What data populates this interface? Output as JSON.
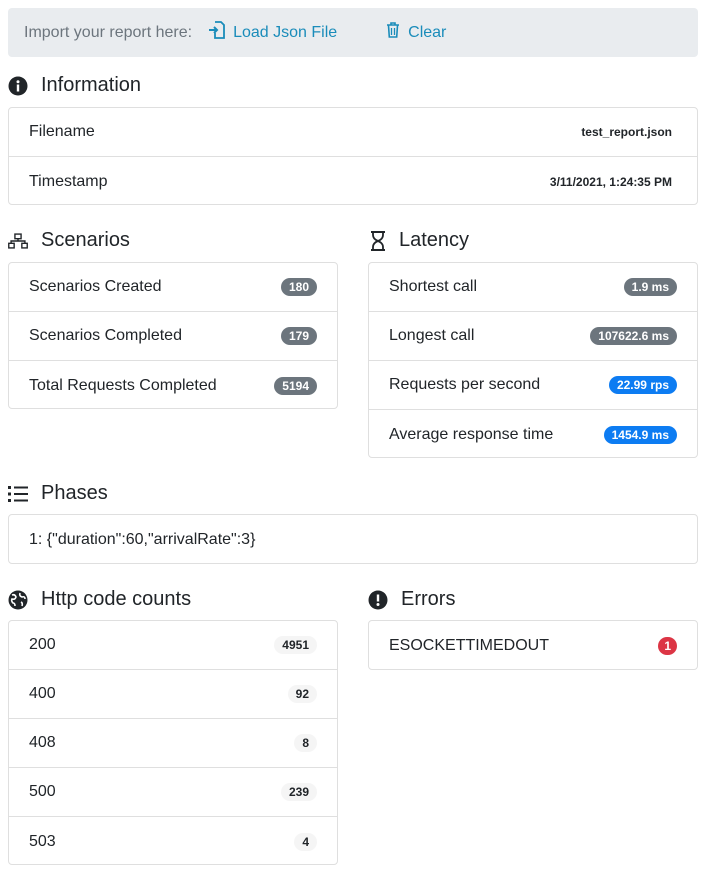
{
  "toolbar": {
    "prompt": "Import your report here:",
    "load_label": "Load Json File",
    "clear_label": "Clear"
  },
  "information": {
    "title": "Information",
    "rows": [
      {
        "label": "Filename",
        "value": "test_report.json"
      },
      {
        "label": "Timestamp",
        "value": "3/11/2021, 1:24:35 PM"
      }
    ]
  },
  "scenarios": {
    "title": "Scenarios",
    "rows": [
      {
        "label": "Scenarios Created",
        "value": "180"
      },
      {
        "label": "Scenarios Completed",
        "value": "179"
      },
      {
        "label": "Total Requests Completed",
        "value": "5194"
      }
    ]
  },
  "latency": {
    "title": "Latency",
    "rows": [
      {
        "label": "Shortest call",
        "value": "1.9 ms"
      },
      {
        "label": "Longest call",
        "value": "107622.6 ms"
      },
      {
        "label": "Requests per second",
        "value": "22.99 rps"
      },
      {
        "label": "Average response time",
        "value": "1454.9 ms"
      }
    ]
  },
  "phases": {
    "title": "Phases",
    "rows": [
      {
        "text": "1: {\"duration\":60,\"arrivalRate\":3}"
      }
    ]
  },
  "http_codes": {
    "title": "Http code counts",
    "rows": [
      {
        "label": "200",
        "value": "4951"
      },
      {
        "label": "400",
        "value": "92"
      },
      {
        "label": "408",
        "value": "8"
      },
      {
        "label": "500",
        "value": "239"
      },
      {
        "label": "503",
        "value": "4"
      }
    ]
  },
  "errors": {
    "title": "Errors",
    "rows": [
      {
        "label": "ESOCKETTIMEDOUT",
        "value": "1"
      }
    ]
  },
  "colors": {
    "link": "#1a8cba",
    "badge_gray": "#6c757d",
    "badge_blue": "#0d7cf2",
    "badge_red": "#dc3545",
    "toolbar_bg": "#e9ecef"
  },
  "icons": {
    "load": "file-import-icon",
    "clear": "trash-icon",
    "information": "info-circle-icon",
    "scenarios": "sitemap-icon",
    "latency": "hourglass-icon",
    "phases": "list-icon",
    "http_codes": "globe-icon",
    "errors": "exclamation-circle-icon"
  }
}
